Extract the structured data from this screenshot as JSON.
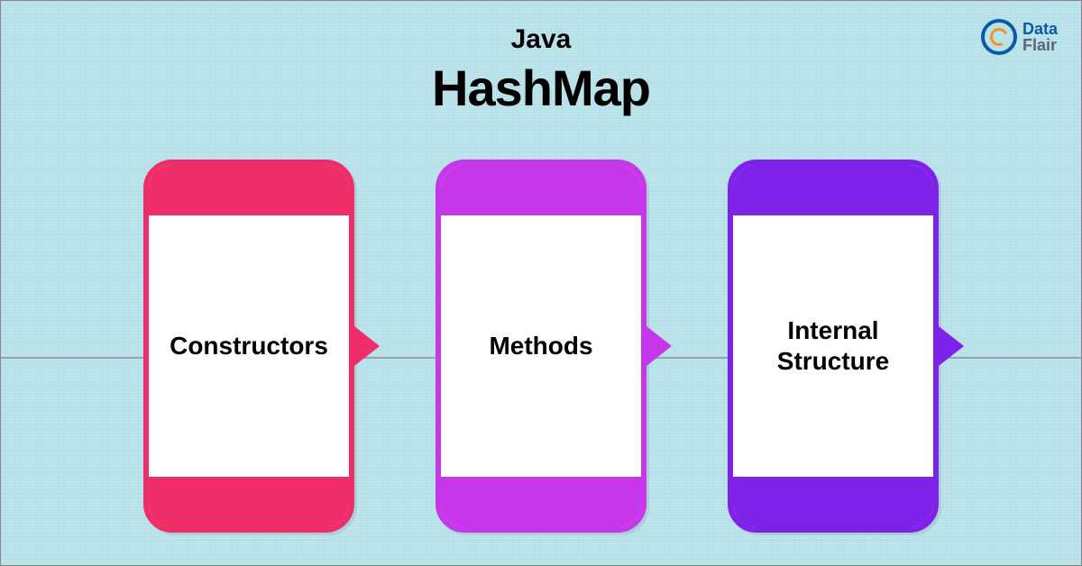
{
  "header": {
    "subtitle": "Java",
    "title": "HashMap"
  },
  "logo": {
    "line1": "Data",
    "line2": "Flair"
  },
  "cards": [
    {
      "label": "Constructors",
      "color": "#ef2d68"
    },
    {
      "label": "Methods",
      "color": "#c637ea"
    },
    {
      "label": "Internal Structure",
      "color": "#7e22ea"
    }
  ]
}
